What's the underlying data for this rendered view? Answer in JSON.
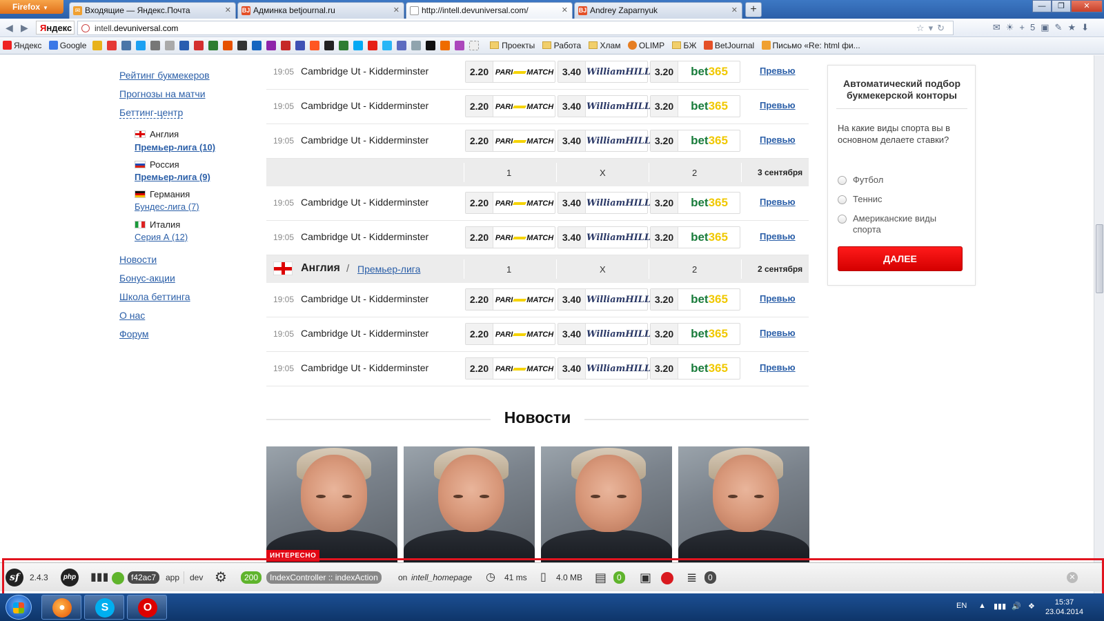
{
  "browser": {
    "menu_button": "Firefox",
    "tabs": [
      {
        "label": "Входящие — Яндекс.Почта",
        "icon": "mail-icon",
        "color": "#f0a030"
      },
      {
        "label": "Админка betjournal.ru",
        "icon": "bj-icon",
        "color": "#e45028"
      },
      {
        "label": "http://intell.devuniversal.com/",
        "icon": "globe-icon",
        "color": "#888888"
      },
      {
        "label": "Andrey Zaparnyuk",
        "icon": "bj-icon",
        "color": "#e45028"
      }
    ],
    "logo": {
      "first": "Я",
      "rest": "ндекс"
    },
    "url_prefix": "intell.",
    "url_host": "devuniversal.com",
    "toolbar_badge": "+5",
    "bookmarks": {
      "yandex": "Яндекс",
      "google": "Google",
      "projects": "Проекты",
      "work": "Работа",
      "junk": "Хлам",
      "olimp": "OLIMP",
      "bzh": "БЖ",
      "betjournal": "BetJournal",
      "letter": "Письмо «Re: html фи..."
    }
  },
  "leftnav": {
    "rating": "Рейтинг букмекеров",
    "forecasts": "Прогнозы на матчи",
    "betting_center": "Беттинг-центр",
    "countries": [
      {
        "name": "Англия",
        "league": "Премьер-лига (10)",
        "bold": true
      },
      {
        "name": "Россия",
        "league": "Премьер-лига (9)",
        "bold": true
      },
      {
        "name": "Германия",
        "league": "Бундес-лига (7)",
        "bold": false
      },
      {
        "name": "Италия",
        "league": "Серия А (12)",
        "bold": false
      }
    ],
    "news": "Новости",
    "bonus": "Бонус-акции",
    "school": "Школа беттинга",
    "about": "О нас",
    "forum": "Форум"
  },
  "matches": {
    "time": "19:05",
    "teams": "Cambridge Ut - Kidderminster",
    "odds": [
      "2.20",
      "3.40",
      "3.20"
    ],
    "bookmakers": {
      "parimatch_a": "PARI",
      "parimatch_b": "MATCH",
      "william": "William",
      "hill": "HILL",
      "bet": "bet",
      "n365": "365"
    },
    "preview": "Превью",
    "header_cols": [
      "1",
      "X",
      "2"
    ],
    "date1": "3 сентября",
    "date2": "2 сентября",
    "country": "Англия",
    "slash": "/",
    "league": "Премьер-лига"
  },
  "news": {
    "title": "Новости",
    "badge": "ИНТЕРЕСНО"
  },
  "widget": {
    "title": "Автоматический подбор букмекерской конторы",
    "question": "На какие виды спорта вы в основном делаете ставки?",
    "options": [
      "Футбол",
      "Теннис",
      "Американские виды спорта"
    ],
    "button": "ДАЛЕЕ"
  },
  "sf_toolbar": {
    "version": "2.4.3",
    "php": "php",
    "token": "f42ac7",
    "app": "app",
    "env": "dev",
    "status": "200",
    "controller": "IndexController :: indexAction",
    "on": "on",
    "route": "intell_homepage",
    "time": "41 ms",
    "memory": "4.0 MB",
    "logs": "0",
    "queries": "0"
  },
  "taskbar": {
    "lang": "EN",
    "time": "15:37",
    "date": "23.04.2014"
  }
}
